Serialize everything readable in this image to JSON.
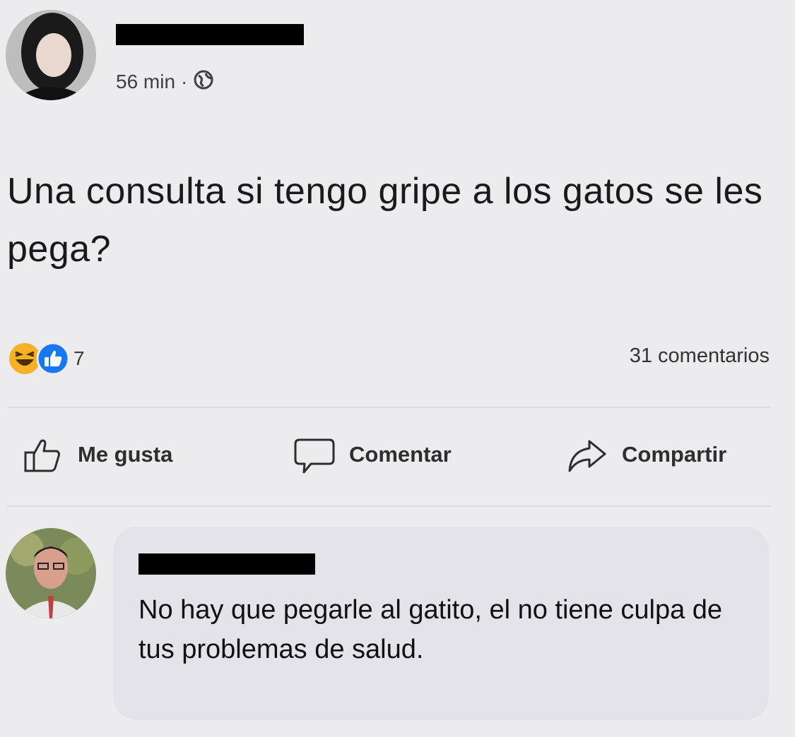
{
  "post": {
    "time": "56 min",
    "separator": "·",
    "audience_icon": "globe-icon",
    "text": "Una consulta si tengo gripe a los gatos se les pega?",
    "reaction_icons": [
      "haha-reaction-icon",
      "like-reaction-icon"
    ],
    "reaction_count": "7",
    "comments_count": "31 comentarios"
  },
  "actions": {
    "like_label": "Me gusta",
    "comment_label": "Comentar",
    "share_label": "Compartir"
  },
  "comment": {
    "text": "No hay que pegarle al gatito, el no tiene culpa de tus problemas de salud."
  },
  "colors": {
    "background": "#ececee",
    "comment_bubble": "#e3e3e9",
    "like_blue": "#1877f2",
    "haha_yellow": "#f7b125"
  }
}
